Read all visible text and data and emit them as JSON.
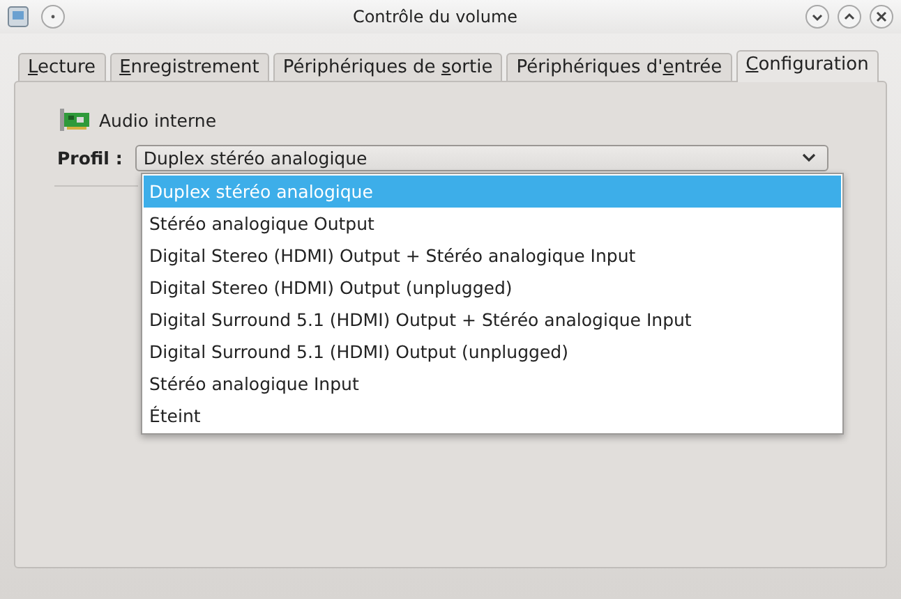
{
  "window": {
    "title": "Contrôle du volume"
  },
  "tabs": [
    {
      "key": "L",
      "after": "ecture",
      "selected": false
    },
    {
      "key": "E",
      "after": "nregistrement",
      "selected": false
    },
    {
      "before": "Périphériques de ",
      "key": "s",
      "after": "ortie",
      "selected": false
    },
    {
      "before": "Périphériques d'",
      "key": "e",
      "after": "ntrée",
      "selected": false
    },
    {
      "key": "C",
      "after": "onfiguration",
      "selected": true
    }
  ],
  "device": {
    "name": "Audio interne"
  },
  "profile": {
    "label": "Profil :",
    "value": "Duplex stéréo analogique",
    "expanded": true,
    "options": [
      {
        "label": "Duplex stéréo analogique",
        "selected": true
      },
      {
        "label": "Stéréo analogique Output",
        "selected": false
      },
      {
        "label": "Digital Stereo (HDMI) Output + Stéréo analogique Input",
        "selected": false
      },
      {
        "label": "Digital Stereo (HDMI) Output (unplugged)",
        "selected": false
      },
      {
        "label": "Digital Surround 5.1 (HDMI) Output + Stéréo analogique Input",
        "selected": false
      },
      {
        "label": "Digital Surround 5.1 (HDMI) Output (unplugged)",
        "selected": false
      },
      {
        "label": "Stéréo analogique Input",
        "selected": false
      },
      {
        "label": "Éteint",
        "selected": false
      }
    ]
  }
}
